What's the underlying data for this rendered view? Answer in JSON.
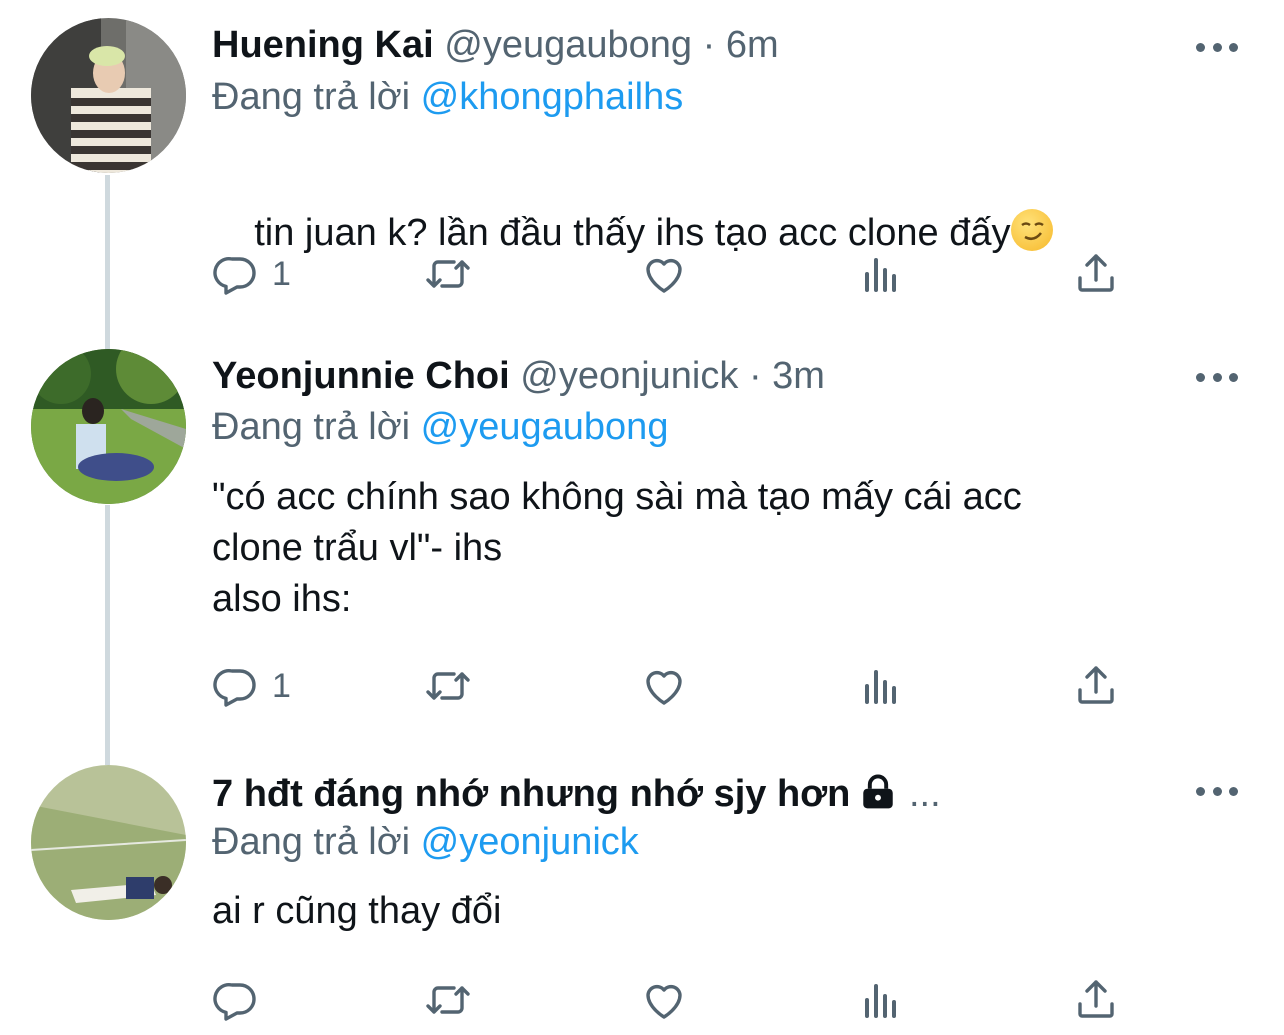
{
  "tweets": [
    {
      "name": "Huening Kai",
      "handle": "@yeugaubong",
      "separator": "·",
      "time": "6m",
      "reply_prefix": "Đang trả lời",
      "reply_mention": "@khongphailhs",
      "text": "tin juan k? lần đầu thấy ihs tạo acc clone đấy",
      "emoji": "smirking-face",
      "reply_count": "1"
    },
    {
      "name": "Yeonjunnie Choi",
      "handle": "@yeonjunick",
      "separator": "·",
      "time": "3m",
      "reply_prefix": "Đang trả lời",
      "reply_mention": "@yeugaubong",
      "text": "\"có acc chính sao không sài mà tạo mấy cái acc\nclone trẩu vl\"- ihs\nalso ihs:",
      "reply_count": "1"
    },
    {
      "name": "7 hđt đáng nhớ nhưng nhớ sjy hơn",
      "name_suffix": "...",
      "locked": true,
      "reply_prefix": "Đang trả lời",
      "reply_mention": "@yeonjunick",
      "text": "ai r cũng thay đổi",
      "reply_count": ""
    }
  ],
  "colors": {
    "text": "#0f1419",
    "secondary": "#536471",
    "link": "#1d9bf0",
    "thread_line": "#cfd9de"
  }
}
